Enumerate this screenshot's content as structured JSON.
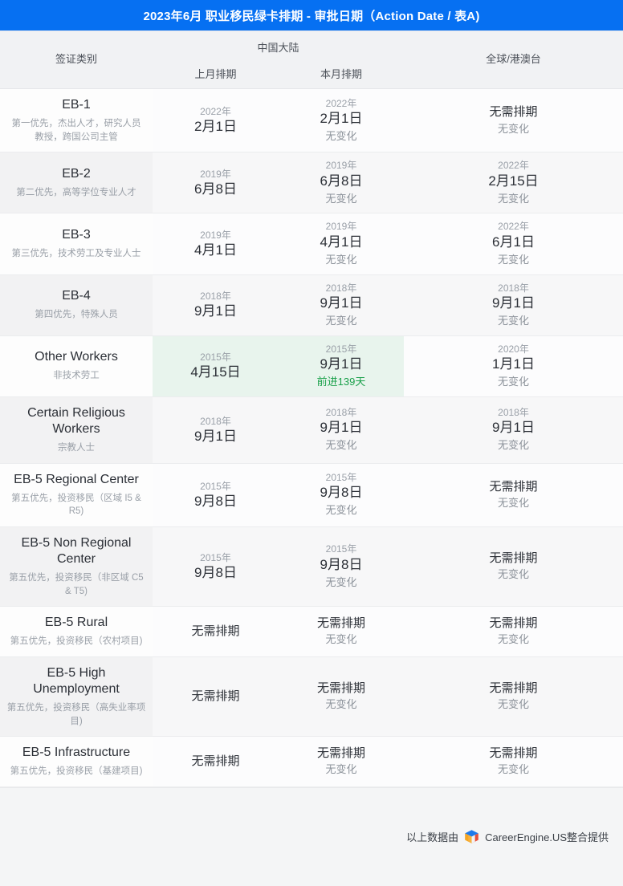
{
  "title_bar": {
    "title": "2023年6月 职业移民绿卡排期 - 审批日期（Action Date / 表A)",
    "background_color": "#0670f2",
    "text_color": "#ffffff"
  },
  "table_header": {
    "category": "签证类别",
    "china_group": "中国大陆",
    "prev_month": "上月排期",
    "current_month": "本月排期",
    "global": "全球/港澳台"
  },
  "colors": {
    "accent": "#0670f2",
    "highlight_bg": "#e8f4ed",
    "advance_text": "#19a04a",
    "row_even_cat": "#f2f2f3",
    "row_even_dat": "#f7f7f8",
    "row_odd": "#fcfcfd",
    "header_bg": "#f1f2f4",
    "footer_bg": "#f4f5f6"
  },
  "rows": [
    {
      "name": "EB-1",
      "desc": "第一优先，杰出人才，研究人员\n教授，跨国公司主管",
      "prev": {
        "year": "2022年",
        "day": "2月1日",
        "note": ""
      },
      "current": {
        "year": "2022年",
        "day": "2月1日",
        "note": "无变化",
        "highlight": false
      },
      "global": {
        "year": "",
        "day": "无需排期",
        "note": "无变化"
      }
    },
    {
      "name": "EB-2",
      "desc": "第二优先，高等学位专业人才",
      "prev": {
        "year": "2019年",
        "day": "6月8日",
        "note": ""
      },
      "current": {
        "year": "2019年",
        "day": "6月8日",
        "note": "无变化",
        "highlight": false
      },
      "global": {
        "year": "2022年",
        "day": "2月15日",
        "note": "无变化"
      }
    },
    {
      "name": "EB-3",
      "desc": "第三优先，技术劳工及专业人士",
      "prev": {
        "year": "2019年",
        "day": "4月1日",
        "note": ""
      },
      "current": {
        "year": "2019年",
        "day": "4月1日",
        "note": "无变化",
        "highlight": false
      },
      "global": {
        "year": "2022年",
        "day": "6月1日",
        "note": "无变化"
      }
    },
    {
      "name": "EB-4",
      "desc": "第四优先，特殊人员",
      "prev": {
        "year": "2018年",
        "day": "9月1日",
        "note": ""
      },
      "current": {
        "year": "2018年",
        "day": "9月1日",
        "note": "无变化",
        "highlight": false
      },
      "global": {
        "year": "2018年",
        "day": "9月1日",
        "note": "无变化"
      }
    },
    {
      "name": "Other Workers",
      "desc": "非技术劳工",
      "prev": {
        "year": "2015年",
        "day": "4月15日",
        "note": ""
      },
      "current": {
        "year": "2015年",
        "day": "9月1日",
        "note": "前进139天",
        "highlight": true
      },
      "global": {
        "year": "2020年",
        "day": "1月1日",
        "note": "无变化"
      }
    },
    {
      "name": "Certain Religious Workers",
      "desc": "宗教人士",
      "prev": {
        "year": "2018年",
        "day": "9月1日",
        "note": ""
      },
      "current": {
        "year": "2018年",
        "day": "9月1日",
        "note": "无变化",
        "highlight": false
      },
      "global": {
        "year": "2018年",
        "day": "9月1日",
        "note": "无变化"
      }
    },
    {
      "name": "EB-5 Regional Center",
      "desc": "第五优先，投资移民（区域 I5 & R5)",
      "prev": {
        "year": "2015年",
        "day": "9月8日",
        "note": ""
      },
      "current": {
        "year": "2015年",
        "day": "9月8日",
        "note": "无变化",
        "highlight": false
      },
      "global": {
        "year": "",
        "day": "无需排期",
        "note": "无变化"
      }
    },
    {
      "name": "EB-5 Non Regional Center",
      "desc": "第五优先，投资移民（非区域 C5 & T5)",
      "prev": {
        "year": "2015年",
        "day": "9月8日",
        "note": ""
      },
      "current": {
        "year": "2015年",
        "day": "9月8日",
        "note": "无变化",
        "highlight": false
      },
      "global": {
        "year": "",
        "day": "无需排期",
        "note": "无变化"
      }
    },
    {
      "name": "EB-5 Rural",
      "desc": "第五优先，投资移民（农村项目)",
      "prev": {
        "year": "",
        "day": "无需排期",
        "note": ""
      },
      "current": {
        "year": "",
        "day": "无需排期",
        "note": "无变化",
        "highlight": false
      },
      "global": {
        "year": "",
        "day": "无需排期",
        "note": "无变化"
      }
    },
    {
      "name": "EB-5 High Unemployment",
      "desc": "第五优先，投资移民（高失业率项目)",
      "prev": {
        "year": "",
        "day": "无需排期",
        "note": ""
      },
      "current": {
        "year": "",
        "day": "无需排期",
        "note": "无变化",
        "highlight": false
      },
      "global": {
        "year": "",
        "day": "无需排期",
        "note": "无变化"
      }
    },
    {
      "name": "EB-5 Infrastructure",
      "desc": "第五优先，投资移民（基建项目)",
      "prev": {
        "year": "",
        "day": "无需排期",
        "note": ""
      },
      "current": {
        "year": "",
        "day": "无需排期",
        "note": "无变化",
        "highlight": false
      },
      "global": {
        "year": "",
        "day": "无需排期",
        "note": "无变化"
      }
    }
  ],
  "footer": {
    "prefix": "以上数据由",
    "logo_icon": "careerengine-cube-logo",
    "brand": "CareerEngine.US整合提供"
  }
}
